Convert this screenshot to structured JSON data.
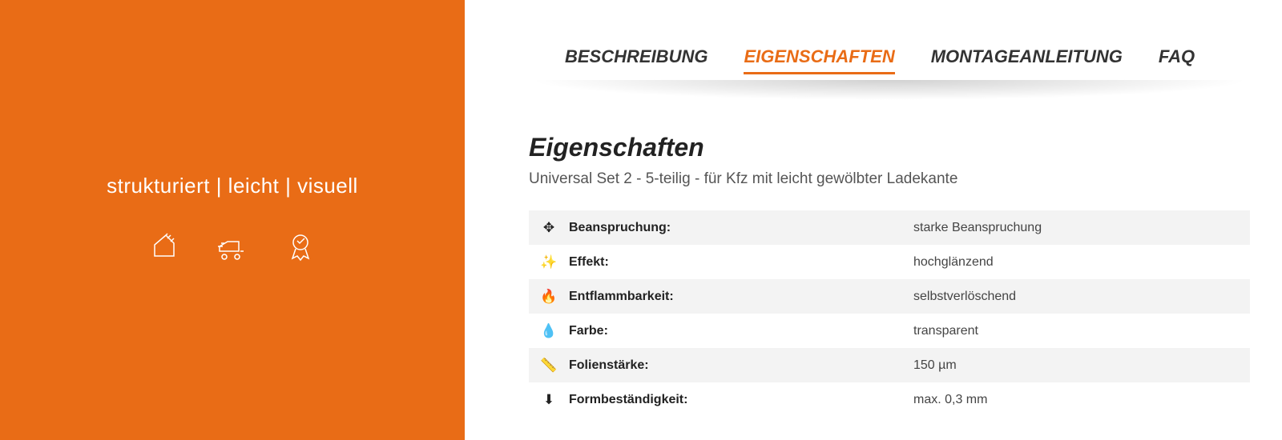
{
  "left": {
    "tagline": "strukturiert | leicht | visuell"
  },
  "tabs": [
    {
      "label": "BESCHREIBUNG",
      "active": false
    },
    {
      "label": "EIGENSCHAFTEN",
      "active": true
    },
    {
      "label": "MONTAGEANLEITUNG",
      "active": false
    },
    {
      "label": "FAQ",
      "active": false
    }
  ],
  "section": {
    "title": "Eigenschaften",
    "subtitle": "Universal Set 2 - 5-teilig - für Kfz mit leicht gewölbter Ladekante"
  },
  "properties": [
    {
      "icon": "✥",
      "label": "Beanspruchung:",
      "value": "starke Beanspruchung"
    },
    {
      "icon": "✨",
      "label": "Effekt:",
      "value": "hochglänzend"
    },
    {
      "icon": "🔥",
      "label": "Entflammbarkeit:",
      "value": "selbstverlöschend"
    },
    {
      "icon": "💧",
      "label": "Farbe:",
      "value": "transparent"
    },
    {
      "icon": "📏",
      "label": "Folienstärke:",
      "value": "150 µm"
    },
    {
      "icon": "⬇",
      "label": "Formbeständigkeit:",
      "value": "max. 0,3 mm"
    }
  ]
}
